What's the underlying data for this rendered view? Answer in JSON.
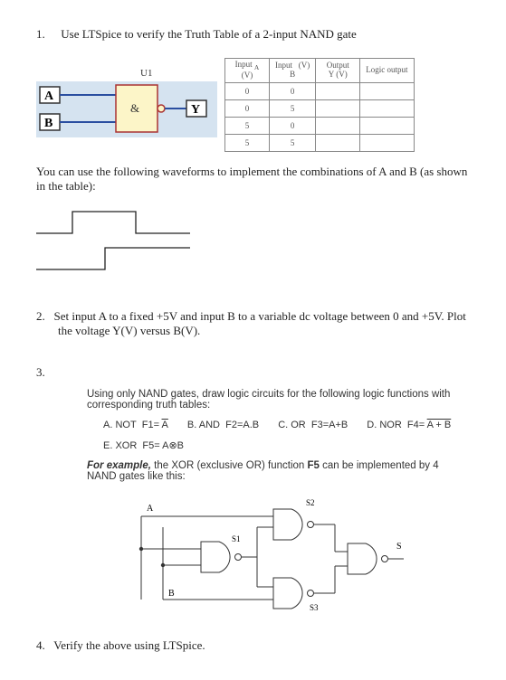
{
  "q1": {
    "num": "1.",
    "text": "Use LTSpice to verify the Truth Table of a 2-input NAND gate"
  },
  "gate": {
    "u1": "U1",
    "a": "A",
    "b": "B",
    "amp": "&",
    "y": "Y"
  },
  "table": {
    "headers": {
      "c1a": "Input",
      "c1b": "(V)",
      "c1mid": "A",
      "c2a": "Input",
      "c2b": "B",
      "c2mid": "(V)",
      "c3a": "Output",
      "c3b": "Y (V)",
      "c4": "Logic output"
    },
    "rows": [
      {
        "a": "0",
        "b": "0",
        "y": "",
        "l": ""
      },
      {
        "a": "0",
        "b": "5",
        "y": "",
        "l": ""
      },
      {
        "a": "5",
        "b": "0",
        "y": "",
        "l": ""
      },
      {
        "a": "5",
        "b": "5",
        "y": "",
        "l": ""
      }
    ]
  },
  "para1": "You can use the following waveforms to implement the combinations of A and B (as shown in the table):",
  "q2": {
    "num": "2.",
    "text": "Set input A to a fixed +5V and input B to a variable dc voltage between 0 and +5V. Plot the voltage Y(V) versus B(V)."
  },
  "q3": {
    "num": "3.",
    "intro": "Using only NAND gates, draw logic circuits for the following logic functions with corresponding truth tables:",
    "funcs": {
      "a_label": "A. NOT",
      "a_eq": "F1= ",
      "a_eqv": "A",
      "b_label": "B.  AND",
      "b_eq": "F2=A.B",
      "c_label": "C. OR",
      "c_eq": "F3=A+B",
      "d_label": "D.  NOR",
      "d_eq": "F4= ",
      "d_eqv": "A + B",
      "e_label": "E. XOR",
      "e_eq": "F5= A⊗B"
    },
    "example_pre": "For example,",
    "example_text": " the XOR (exclusive OR) function ",
    "example_f5": "F5",
    "example_post": " can be implemented by 4 NAND gates like this:"
  },
  "xor": {
    "a": "A",
    "b": "B",
    "s1": "S1",
    "s2": "S2",
    "s3": "S3",
    "s": "S"
  },
  "q4": {
    "num": "4.",
    "text": "Verify the above using LTSpice."
  }
}
